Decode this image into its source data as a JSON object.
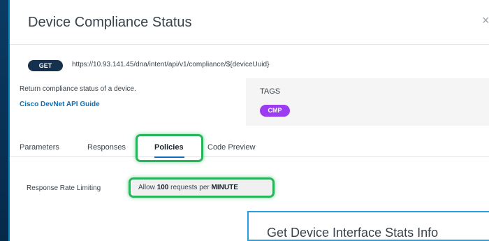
{
  "modal": {
    "title": "Device Compliance Status",
    "close_glyph": "×"
  },
  "endpoint": {
    "method": "GET",
    "url": "https://10.93.141.45/dna/intent/api/v1/compliance/${deviceUuid}",
    "description": "Return compliance status of a device.",
    "guide_link": "Cisco DevNet API Guide"
  },
  "tags": {
    "label": "TAGS",
    "items": [
      "CMP"
    ]
  },
  "tabs": [
    {
      "label": "Parameters",
      "active": false
    },
    {
      "label": "Responses",
      "active": false
    },
    {
      "label": "Policies",
      "active": true
    },
    {
      "label": "Code Preview",
      "active": false
    }
  ],
  "policies": {
    "rate_label": "Response Rate Limiting",
    "rate_prefix": "Allow",
    "rate_count": "100",
    "rate_middle": "requests per",
    "rate_unit": "MINUTE"
  },
  "related_card": {
    "title": "Get Device Interface Stats Info"
  },
  "colors": {
    "method_badge": "#15314d",
    "tag_chip": "#9b3cf2",
    "link": "#0d6fb8",
    "highlight": "#28b45a",
    "active_tab_underline": "#0d6fb8",
    "card_border": "#26a0e0"
  }
}
